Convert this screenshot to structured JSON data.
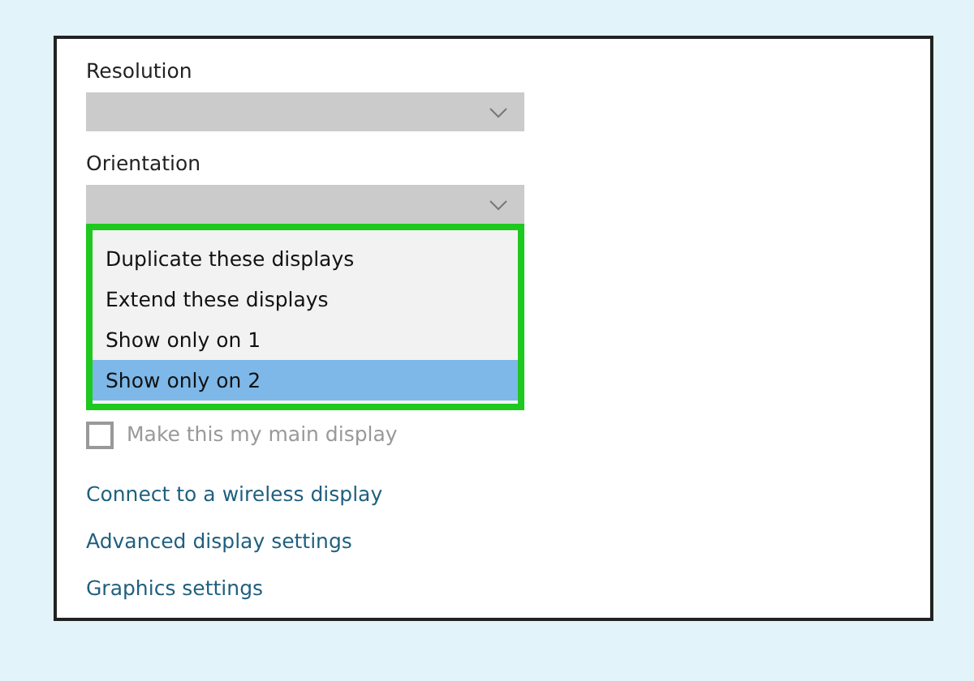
{
  "fields": [
    {
      "label": "Resolution"
    },
    {
      "label": "Orientation"
    }
  ],
  "dropdown_options": [
    {
      "label": "Duplicate these displays",
      "selected": false
    },
    {
      "label": "Extend these displays",
      "selected": false
    },
    {
      "label": "Show only on 1",
      "selected": false
    },
    {
      "label": "Show only on 2",
      "selected": true
    }
  ],
  "main_display_checkbox": {
    "label": "Make this my main display",
    "checked": false,
    "disabled": true
  },
  "links": [
    "Connect to a wireless display",
    "Advanced display settings",
    "Graphics settings"
  ]
}
